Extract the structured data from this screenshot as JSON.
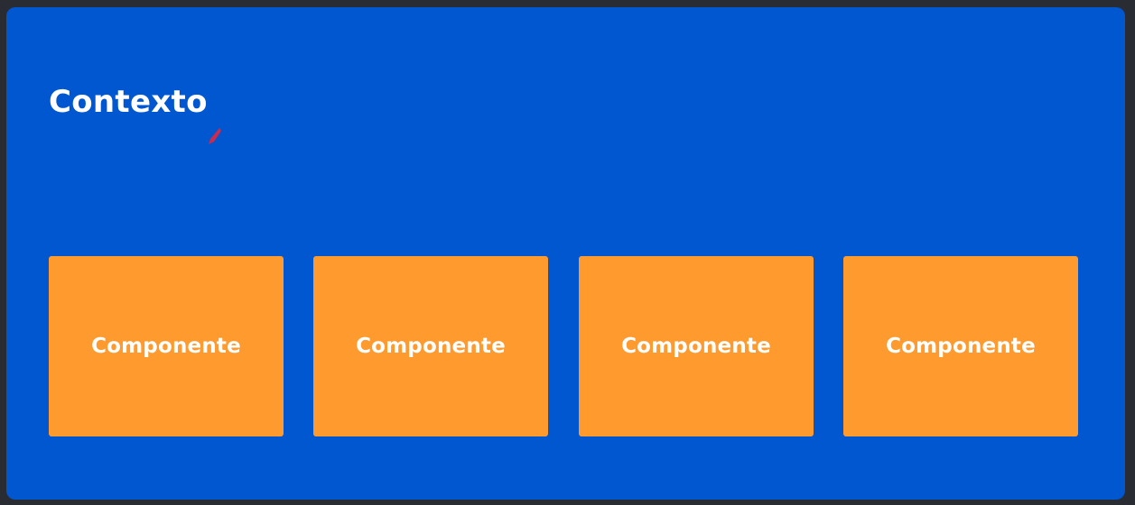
{
  "context": {
    "title": "Contexto"
  },
  "components": [
    {
      "label": "Componente"
    },
    {
      "label": "Componente"
    },
    {
      "label": "Componente"
    },
    {
      "label": "Componente"
    }
  ],
  "colors": {
    "background": "#2a2c33",
    "context": "#0057cf",
    "component": "#ff9a2e",
    "text": "#ffffff",
    "pointer": "#e3263f"
  }
}
